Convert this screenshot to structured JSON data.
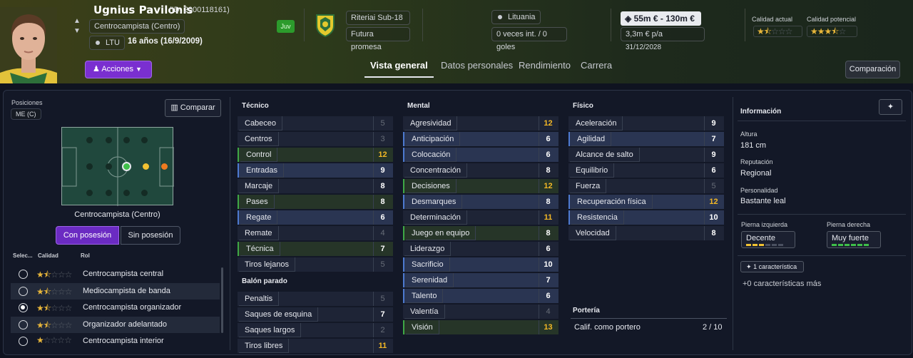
{
  "header": {
    "name": "Ugnius Pavilonis",
    "id": "(ID: 2000118161)",
    "position": "Centrocampista (Centro)",
    "nation_code": "LTU",
    "age": "16 años (16/9/2009)",
    "juv": "Juv",
    "club": "Riteriai Sub-18",
    "club_status": "Futura promesa",
    "nationality": "Lituania",
    "intl": "0 veces int. / 0 goles",
    "value": "55m € - 130m €",
    "wage": "3,3m € p/a",
    "contract": "31/12/2028",
    "ca_label": "Calidad actual",
    "pa_label": "Calidad potencial",
    "ca_stars": 1.5,
    "pa_stars": 3.5,
    "actions": "Acciones",
    "compare_btn": "Comparación",
    "tabs": [
      "Vista general",
      "Datos personales",
      "Rendimiento",
      "Carrera"
    ]
  },
  "left": {
    "positions_label": "Posiciones",
    "pos_chip": "ME (C)",
    "compare": "Comparar",
    "role_name": "Centrocampista (Centro)",
    "with_ball": "Con posesión",
    "without_ball": "Sin posesión",
    "col_sel": "Selec...",
    "col_quality": "Calidad",
    "col_role": "Rol",
    "roles": [
      {
        "name": "Centrocampista central",
        "stars": 1.5,
        "selected": false
      },
      {
        "name": "Mediocampista de banda",
        "stars": 1.5,
        "selected": false
      },
      {
        "name": "Centrocampista organizador",
        "stars": 1.5,
        "selected": true
      },
      {
        "name": "Organizador adelantado",
        "stars": 1.5,
        "selected": false
      },
      {
        "name": "Centrocampista interior",
        "stars": 1,
        "selected": false
      }
    ]
  },
  "technical": {
    "title": "Técnico",
    "attrs": [
      {
        "n": "Cabeceo",
        "v": 5
      },
      {
        "n": "Centros",
        "v": 3
      },
      {
        "n": "Control",
        "v": 12
      },
      {
        "n": "Entradas",
        "v": 9
      },
      {
        "n": "Marcaje",
        "v": 8
      },
      {
        "n": "Pases",
        "v": 8
      },
      {
        "n": "Regate",
        "v": 6
      },
      {
        "n": "Remate",
        "v": 4
      },
      {
        "n": "Técnica",
        "v": 7
      },
      {
        "n": "Tiros lejanos",
        "v": 5
      }
    ]
  },
  "setpieces": {
    "title": "Balón parado",
    "attrs": [
      {
        "n": "Penaltis",
        "v": 5
      },
      {
        "n": "Saques de esquina",
        "v": 7
      },
      {
        "n": "Saques largos",
        "v": 2
      },
      {
        "n": "Tiros libres",
        "v": 11
      }
    ]
  },
  "mental": {
    "title": "Mental",
    "attrs": [
      {
        "n": "Agresividad",
        "v": 12
      },
      {
        "n": "Anticipación",
        "v": 6
      },
      {
        "n": "Colocación",
        "v": 6
      },
      {
        "n": "Concentración",
        "v": 8
      },
      {
        "n": "Decisiones",
        "v": 12
      },
      {
        "n": "Desmarques",
        "v": 8
      },
      {
        "n": "Determinación",
        "v": 11
      },
      {
        "n": "Juego en equipo",
        "v": 8
      },
      {
        "n": "Liderazgo",
        "v": 6
      },
      {
        "n": "Sacrificio",
        "v": 10
      },
      {
        "n": "Serenidad",
        "v": 7
      },
      {
        "n": "Talento",
        "v": 6
      },
      {
        "n": "Valentía",
        "v": 4
      },
      {
        "n": "Visión",
        "v": 13
      }
    ]
  },
  "physical": {
    "title": "Físico",
    "attrs": [
      {
        "n": "Aceleración",
        "v": 9
      },
      {
        "n": "Agilidad",
        "v": 7
      },
      {
        "n": "Alcance de salto",
        "v": 9
      },
      {
        "n": "Equilibrio",
        "v": 6
      },
      {
        "n": "Fuerza",
        "v": 5
      },
      {
        "n": "Recuperación física",
        "v": 12
      },
      {
        "n": "Resistencia",
        "v": 10
      },
      {
        "n": "Velocidad",
        "v": 8
      }
    ]
  },
  "goalkeeping": {
    "title": "Portería",
    "label": "Calif. como portero",
    "value": "2 / 10"
  },
  "info": {
    "title": "Información",
    "height_label": "Altura",
    "height": "181 cm",
    "rep_label": "Reputación",
    "rep": "Regional",
    "pers_label": "Personalidad",
    "pers": "Bastante leal",
    "lf_label": "Pierna izquierda",
    "lf": "Decente",
    "lf_level": 3,
    "rf_label": "Pierna derecha",
    "rf": "Muy fuerte",
    "rf_level": 6,
    "traits_chip": "1 característica",
    "more": "+0 características más"
  }
}
